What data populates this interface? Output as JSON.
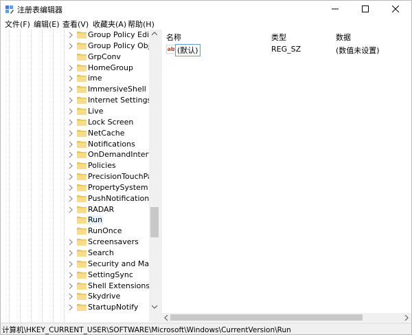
{
  "window": {
    "title": "注册表编辑器",
    "controls": {
      "minimize": "—",
      "maximize": "☐",
      "close": "✕"
    }
  },
  "menu": [
    {
      "label": "文件(F)"
    },
    {
      "label": "编辑(E)"
    },
    {
      "label": "查看(V)"
    },
    {
      "label": "收藏夹(A)"
    },
    {
      "label": "帮助(H)"
    }
  ],
  "tree": {
    "items": [
      {
        "label": "Group Policy Editor",
        "has_children": true,
        "selected": false
      },
      {
        "label": "Group Policy Objec",
        "has_children": true,
        "selected": false
      },
      {
        "label": "GrpConv",
        "has_children": false,
        "selected": false
      },
      {
        "label": "HomeGroup",
        "has_children": true,
        "selected": false
      },
      {
        "label": "ime",
        "has_children": true,
        "selected": false
      },
      {
        "label": "ImmersiveShell",
        "has_children": true,
        "selected": false
      },
      {
        "label": "Internet Settings",
        "has_children": true,
        "selected": false
      },
      {
        "label": "Live",
        "has_children": true,
        "selected": false
      },
      {
        "label": "Lock Screen",
        "has_children": true,
        "selected": false
      },
      {
        "label": "NetCache",
        "has_children": true,
        "selected": false
      },
      {
        "label": "Notifications",
        "has_children": true,
        "selected": false
      },
      {
        "label": "OnDemandInterface",
        "has_children": true,
        "selected": false
      },
      {
        "label": "Policies",
        "has_children": true,
        "selected": false
      },
      {
        "label": "PrecisionTouchPad",
        "has_children": true,
        "selected": false
      },
      {
        "label": "PropertySystem",
        "has_children": true,
        "selected": false
      },
      {
        "label": "PushNotifications",
        "has_children": true,
        "selected": false
      },
      {
        "label": "RADAR",
        "has_children": true,
        "selected": false
      },
      {
        "label": "Run",
        "has_children": false,
        "selected": true
      },
      {
        "label": "RunOnce",
        "has_children": false,
        "selected": false
      },
      {
        "label": "Screensavers",
        "has_children": true,
        "selected": false
      },
      {
        "label": "Search",
        "has_children": true,
        "selected": false
      },
      {
        "label": "Security and Mainte",
        "has_children": true,
        "selected": false
      },
      {
        "label": "SettingSync",
        "has_children": true,
        "selected": false
      },
      {
        "label": "Shell Extensions",
        "has_children": true,
        "selected": false
      },
      {
        "label": "Skydrive",
        "has_children": true,
        "selected": false
      },
      {
        "label": "StartupNotify",
        "has_children": true,
        "selected": false
      }
    ]
  },
  "values_list": {
    "columns": {
      "name": "名称",
      "type": "类型",
      "data": "数据"
    },
    "rows": [
      {
        "icon": "ab",
        "name": "(默认)",
        "type": "REG_SZ",
        "data": "(数值未设置)"
      }
    ]
  },
  "status": {
    "path": "计算机\\HKEY_CURRENT_USER\\SOFTWARE\\Microsoft\\Windows\\CurrentVersion\\Run"
  },
  "colors": {
    "folder": "#e8c35a",
    "folder_light": "#f6dc8c",
    "selection": "#e5f3ff",
    "string_icon": "#c0392b"
  }
}
